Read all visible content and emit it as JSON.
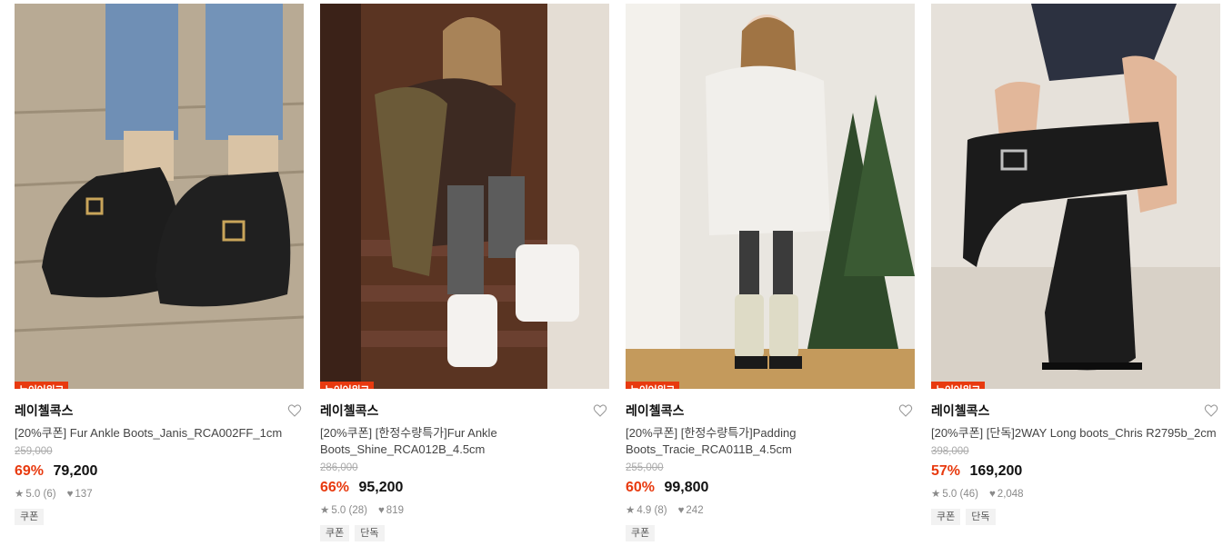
{
  "products": [
    {
      "tag": "뉴이어위크",
      "brand": "레이첼콕스",
      "title": "[20%쿠폰] Fur Ankle Boots_Janis_RCA002FF_1cm",
      "original_price": "259,000",
      "discount": "69%",
      "price": "79,200",
      "rating": "5.0",
      "reviews": "(6)",
      "likes": "137",
      "badges": [
        "쿠폰"
      ],
      "image_icon": "boots-photo"
    },
    {
      "tag": "뉴이어위크",
      "brand": "레이첼콕스",
      "title": "[20%쿠폰] [한정수량특가]Fur Ankle Boots_Shine_RCA012B_4.5cm",
      "original_price": "286,000",
      "discount": "66%",
      "price": "95,200",
      "rating": "5.0",
      "reviews": "(28)",
      "likes": "819",
      "badges": [
        "쿠폰",
        "단독"
      ],
      "image_icon": "model-photo"
    },
    {
      "tag": "뉴이어위크",
      "brand": "레이첼콕스",
      "title": "[20%쿠폰] [한정수량특가]Padding Boots_Tracie_RCA011B_4.5cm",
      "original_price": "255,000",
      "discount": "60%",
      "price": "99,800",
      "rating": "4.9",
      "reviews": "(8)",
      "likes": "242",
      "badges": [
        "쿠폰"
      ],
      "image_icon": "model-photo"
    },
    {
      "tag": "뉴이어위크",
      "brand": "레이첼콕스",
      "title": "[20%쿠폰] [단독]2WAY Long boots_Chris R2795b_2cm",
      "original_price": "398,000",
      "discount": "57%",
      "price": "169,200",
      "rating": "5.0",
      "reviews": "(46)",
      "likes": "2,048",
      "badges": [
        "쿠폰",
        "단독"
      ],
      "image_icon": "boots-photo"
    }
  ],
  "colors": {
    "accent": "#e83a0f",
    "text": "#111111",
    "muted": "#8a8a8a"
  }
}
